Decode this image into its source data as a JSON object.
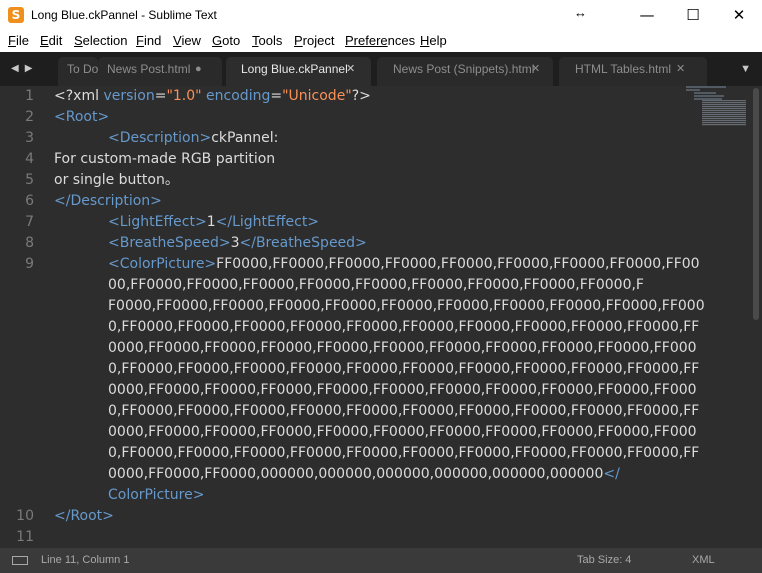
{
  "window": {
    "app_icon": "S",
    "title": "Long Blue.ckPannel - Sublime Text",
    "minimize_icon": "—",
    "maximize_icon": "☐",
    "close_icon": "✕",
    "resize_icon": "↔"
  },
  "menu": [
    {
      "acc": "F",
      "rest": "ile"
    },
    {
      "acc": "E",
      "rest": "dit"
    },
    {
      "acc": "S",
      "rest": "election"
    },
    {
      "acc": "F",
      "rest": "ind"
    },
    {
      "acc": "V",
      "rest": "iew"
    },
    {
      "acc": "G",
      "rest": "oto"
    },
    {
      "acc": "T",
      "rest": "ools"
    },
    {
      "acc": "P",
      "rest": "roject"
    },
    {
      "acc": "Prefere",
      "rest": "nces"
    },
    {
      "acc": "H",
      "rest": "elp"
    }
  ],
  "tabs": [
    {
      "label": "To Do",
      "close": "",
      "dirty": ""
    },
    {
      "label": "News Post.html",
      "close": "",
      "dirty": "●"
    },
    {
      "label": "Long Blue.ckPannel",
      "close": "✕",
      "dirty": ""
    },
    {
      "label": "News Post (Snippets).html",
      "close": "✕",
      "dirty": ""
    },
    {
      "label": "HTML Tables.html",
      "close": "✕",
      "dirty": ""
    }
  ],
  "tab_nav": {
    "left": "◀",
    "right": "▶",
    "dropdown": "▼"
  },
  "editor": {
    "line_numbers": [
      "1",
      "2",
      "3",
      "4",
      "5",
      "6",
      "7",
      "8",
      "9",
      "10",
      "11"
    ],
    "line1": {
      "a": "<?xml ",
      "b": "version",
      "c": "=",
      "d": "\"1.0\"",
      "e": " encoding",
      "f": "=",
      "g": "\"Unicode\"",
      "h": "?>"
    },
    "line2": {
      "a": "<Root>"
    },
    "line3": {
      "a": "<Description>",
      "b": "ckPannel:"
    },
    "line4": {
      "a": "For custom-made RGB partition"
    },
    "line5": {
      "a": "or single button。"
    },
    "line6": {
      "a": "</Description>"
    },
    "line7": {
      "a": "<LightEffect>",
      "b": "1",
      "c": "</LightEffect>"
    },
    "line8": {
      "a": "<BreatheSpeed>",
      "b": "3",
      "c": "</BreatheSpeed>"
    },
    "line9": {
      "a": "<ColorPicture>",
      "b": "FF0000,FF0000,FF0000,FF0000,FF0000,FF0000,FF0000,FF0000,FF00"
    },
    "line9_wrap": [
      "00,FF0000,FF0000,FF0000,FF0000,FF0000,FF0000,FF0000,FF0000,FF0000,F",
      "F0000,FF0000,FF0000,FF0000,FF0000,FF0000,FF0000,FF0000,FF0000,FF0000,FF000",
      "0,FF0000,FF0000,FF0000,FF0000,FF0000,FF0000,FF0000,FF0000,FF0000,FF0000,FF",
      "0000,FF0000,FF0000,FF0000,FF0000,FF0000,FF0000,FF0000,FF0000,FF0000,FF000",
      "0,FF0000,FF0000,FF0000,FF0000,FF0000,FF0000,FF0000,FF0000,FF0000,FF0000,FF",
      "0000,FF0000,FF0000,FF0000,FF0000,FF0000,FF0000,FF0000,FF0000,FF0000,FF000",
      "0,FF0000,FF0000,FF0000,FF0000,FF0000,FF0000,FF0000,FF0000,FF0000,FF0000,FF",
      "0000,FF0000,FF0000,FF0000,FF0000,FF0000,FF0000,FF0000,FF0000,FF0000,FF000",
      "0,FF0000,FF0000,FF0000,FF0000,FF0000,FF0000,FF0000,FF0000,FF0000,FF0000,FF"
    ],
    "line9_last": {
      "a": "0000,FF0000,FF0000,000000,000000,000000,000000,000000,000000",
      "b": "</"
    },
    "line9_close": {
      "a": "ColorPicture>"
    },
    "line10": {
      "a": "</Root>"
    }
  },
  "status": {
    "panel_icon": "panel-icon",
    "position": "Line 11, Column 1",
    "tab_size": "Tab Size: 4",
    "syntax": "XML"
  },
  "colors": {
    "editor_bg": "#2d2d2d",
    "tag": "#6699cc",
    "string": "#f99157",
    "text": "#dcdcdc",
    "line_number": "#7a7a7a",
    "tabbar_bg": "#1e1e1e",
    "statusbar_bg": "#3a3a3a"
  }
}
